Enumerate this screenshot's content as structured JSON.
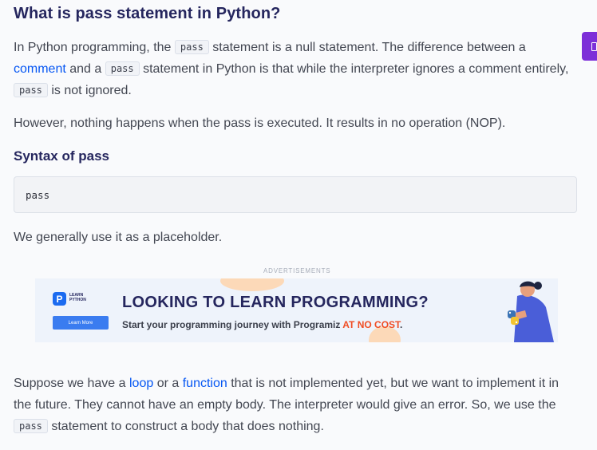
{
  "heading": "What is pass statement in Python?",
  "p1": {
    "t1": "In Python programming, the ",
    "code1": "pass",
    "t2": " statement is a null statement. The difference between a ",
    "link": "comment",
    "t3": " and a ",
    "code2": "pass",
    "t4": " statement in Python is that while the interpreter ignores a comment entirely, ",
    "code3": "pass",
    "t5": " is not ignored."
  },
  "p2": "However, nothing happens when the pass is executed. It results in no operation (NOP).",
  "syntax_heading": "Syntax of pass",
  "code_block": "pass",
  "p3": "We generally use it as a placeholder.",
  "ad": {
    "label": "ADVERTISEMENTS",
    "logo_letter": "P",
    "logo_line1": "LEARN",
    "logo_line2": "PYTHON",
    "button": "Learn More",
    "headline": "LOOKING TO LEARN PROGRAMMING?",
    "sub_text": "Start your programming journey with Programiz ",
    "sub_accent": "AT NO COST",
    "sub_end": ".",
    "colors": {
      "accent": "#f04d24",
      "button": "#3a7cf0",
      "navy": "#25265e"
    }
  },
  "p4": {
    "t1": "Suppose we have a ",
    "link1": "loop",
    "t2": " or a ",
    "link2": "function",
    "t3": " that is not implemented yet, but we want to implement it in the future. They cannot have an empty body. The interpreter would give an error. So, we use the ",
    "code": "pass",
    "t4": " statement to construct a body that does nothing."
  },
  "colors": {
    "heading": "#25265e",
    "link": "#0556f3",
    "side_tab": "#7d2fd8"
  }
}
